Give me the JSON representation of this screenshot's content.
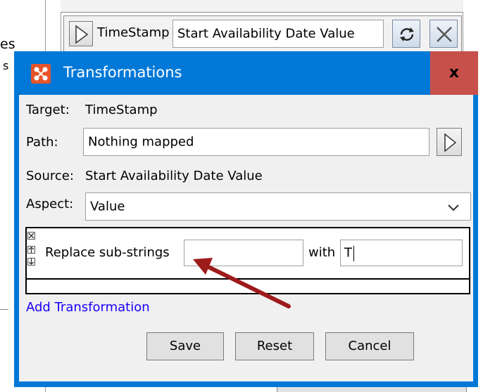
{
  "background": {
    "left_text_1": "es",
    "left_text_2": "s",
    "row": {
      "target_label": "TimeStamp",
      "source_value": "Start Availability Date Value"
    }
  },
  "dialog": {
    "title": "Transformations",
    "close_label": "x",
    "target_label": "Target:",
    "target_value": "TimeStamp",
    "path_label": "Path:",
    "path_value": "Nothing mapped",
    "source_label": "Source:",
    "source_value": "Start Availability Date Value",
    "aspect_label": "Aspect:",
    "aspect_value": "Value",
    "transformation": {
      "label": "Replace sub-strings",
      "find_value": "",
      "with_label": "with",
      "replace_value": "T"
    },
    "add_transformation": "Add Transformation",
    "buttons": {
      "save": "Save",
      "reset": "Reset",
      "cancel": "Cancel"
    }
  },
  "colors": {
    "title_bar": "#0078d7",
    "close_button": "#c8504a",
    "arrow": "#9e1b1b",
    "link": "#1a00ff"
  }
}
